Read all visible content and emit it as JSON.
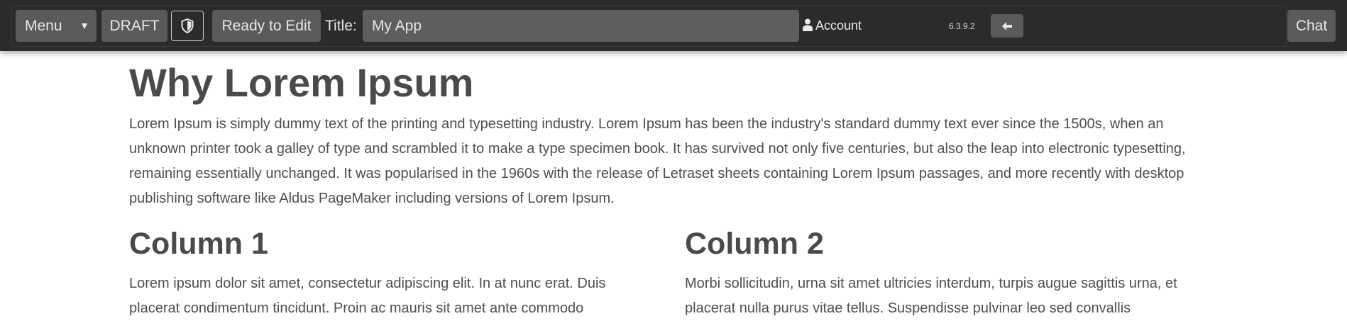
{
  "toolbar": {
    "menu_label": "Menu",
    "menu_caret": "▼",
    "draft_label": "DRAFT",
    "shield_icon": "shield-icon",
    "ready_label": "Ready to Edit",
    "title_label": "Title:",
    "title_value": "My App",
    "account_label": "Account",
    "account_icon": "user-icon",
    "version": "6.3.9.2",
    "back_icon": "arrow-left-icon",
    "chat_label": "Chat"
  },
  "page": {
    "heading": "Why Lorem Ipsum",
    "intro": "Lorem Ipsum is simply dummy text of the printing and typesetting industry. Lorem Ipsum has been the industry's standard dummy text ever since the 1500s, when an unknown printer took a galley of type and scrambled it to make a type specimen book. It has survived not only five centuries, but also the leap into electronic typesetting, remaining essentially unchanged. It was popularised in the 1960s with the release of Letraset sheets containing Lorem Ipsum passages, and more recently with desktop publishing software like Aldus PageMaker including versions of Lorem Ipsum.",
    "columns": [
      {
        "heading": "Column 1",
        "text": "Lorem ipsum dolor sit amet, consectetur adipiscing elit. In at nunc erat. Duis placerat condimentum tincidunt. Proin ac mauris sit amet ante commodo"
      },
      {
        "heading": "Column 2",
        "text": "Morbi sollicitudin, urna sit amet ultricies interdum, turpis augue sagittis urna, et placerat nulla purus vitae tellus. Suspendisse pulvinar leo sed convallis"
      }
    ]
  },
  "colors": {
    "toolbar_bg": "#2b2b2b",
    "button_bg": "#5a5a5a",
    "text": "#4a4a4a"
  }
}
